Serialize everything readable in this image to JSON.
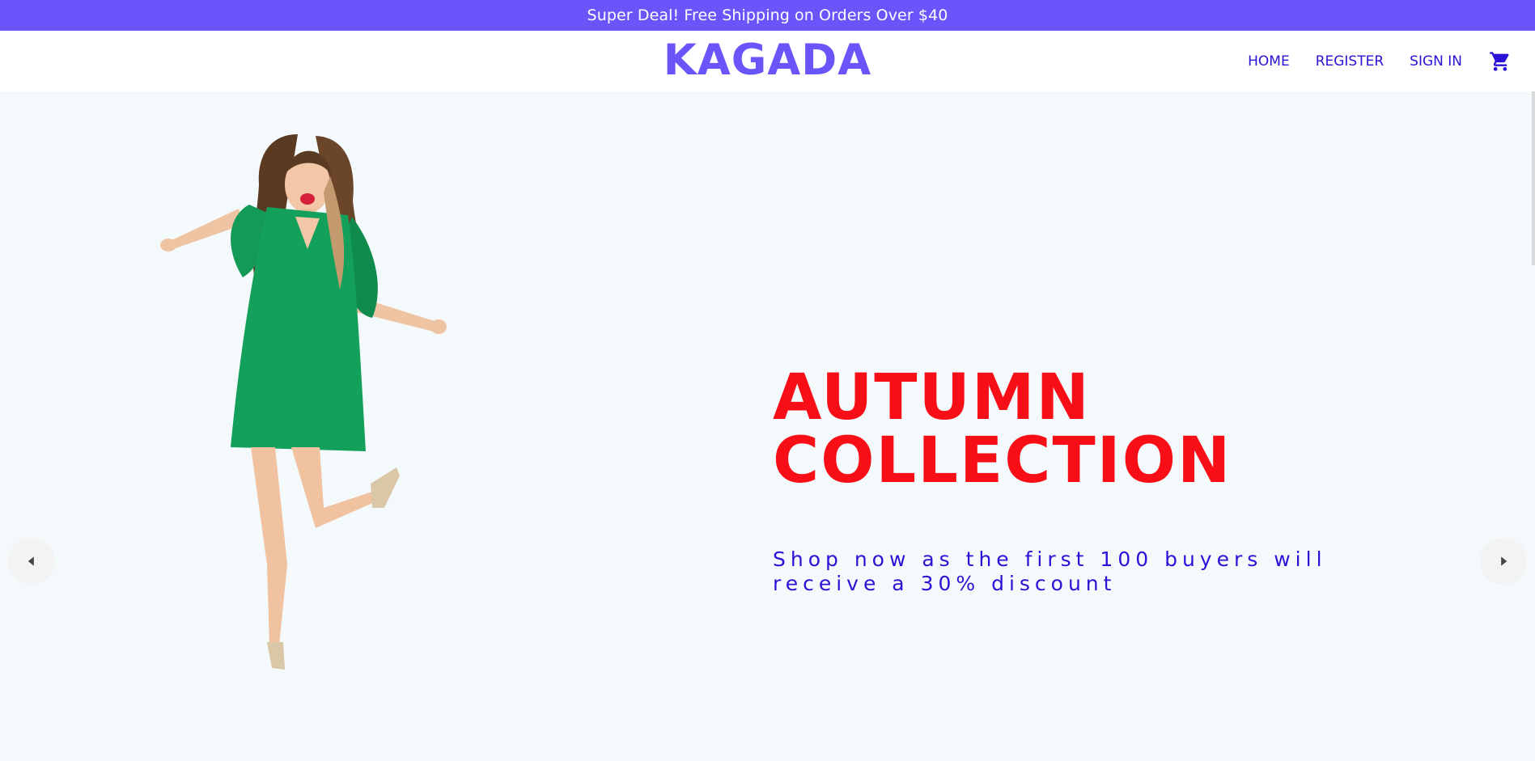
{
  "announcement": {
    "text": "Super Deal! Free Shipping on Orders Over $40"
  },
  "navbar": {
    "logo": "KAGADA",
    "menu": [
      "HOME",
      "REGISTER",
      "SIGN IN"
    ],
    "cart_icon": "shopping-cart-icon"
  },
  "hero": {
    "title": "AUTUMN COLLECTION",
    "subtitle": "Shop now as the first 100 buyers will receive a 30% discount",
    "prev_icon": "arrow-left-icon",
    "next_icon": "arrow-right-icon"
  },
  "colors": {
    "brand": "#6a55fb",
    "title": "#f70e16",
    "nav_text": "#2a12d6",
    "hero_bg": "#f4f9fb"
  }
}
